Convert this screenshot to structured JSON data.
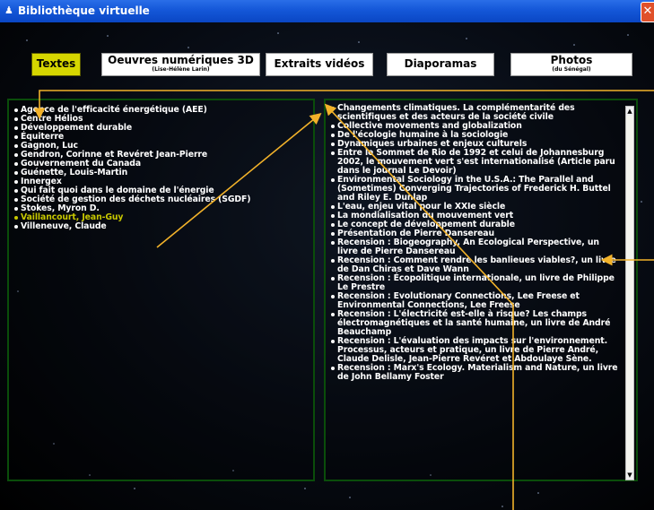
{
  "window": {
    "title": "Bibliothèque virtuelle",
    "app_icon": "person-icon",
    "close_label": "✕"
  },
  "tabs": [
    {
      "label": "Textes",
      "sub": "",
      "active": true
    },
    {
      "label": "Oeuvres numériques 3D",
      "sub": "(Lise-Hélène Larin)",
      "active": false
    },
    {
      "label": "Extraits vidéos",
      "sub": "",
      "active": false
    },
    {
      "label": "Diaporamas",
      "sub": "",
      "active": false
    },
    {
      "label": "Photos",
      "sub": "(du Sénégal)",
      "active": false
    }
  ],
  "authors": [
    "Agence de l'efficacité énergétique (AEE)",
    "Centre Hélios",
    "Développement durable",
    "Équiterre",
    "Gagnon, Luc",
    "Gendron, Corinne et Revéret Jean-Pierre",
    "Gouvernement du Canada",
    "Guénette, Louis-Martin",
    "Innergex",
    "Qui fait quoi dans le domaine de l'énergie",
    "Société de gestion des déchets nucléaires (SGDF)",
    "Stokes, Myron D.",
    "Vaillancourt, Jean-Guy",
    "Villeneuve, Claude"
  ],
  "selected_author": "Vaillancourt, Jean-Guy",
  "documents": [
    "Changements climatiques. La complémentarité des scientifiques et des acteurs de la société civile",
    "Collective movements and globalization",
    "De l'écologie humaine à la sociologie",
    "Dynamiques urbaines et enjeux culturels",
    "Entre le Sommet de Rio de 1992 et celui de Johannesburg 2002, le mouvement vert s'est internationalisé (Article paru dans le journal Le Devoir)",
    "Environmental Sociology in the U.S.A.: The Parallel and (Sometimes) Converging Trajectories of Frederick H. Buttel and Riley E. Dunlap",
    "L'eau, enjeu vital pour le XXIe siècle",
    "La mondialisation du mouvement vert",
    "Le concept de développement durable",
    "Présentation de Pierre Dansereau",
    "Recension : Biogeography, An Ecological Perspective, un livre de Pierre Dansereau",
    "Recension : Comment rendre les banlieues viables?, un livre de Dan Chiras et Dave Wann",
    "Recension : Écopolitique internationale, un livre de Philippe Le Prestre",
    "Recension : Evolutionary Connections, Lee Freese et Environmental Connections, Lee Freese",
    "Recension : L'électricité est-elle à risque? Les champs électromagnétiques et la santé humaine, un livre de André Beauchamp",
    "Recension : L'évaluation des impacts sur l'environnement. Processus, acteurs et pratique, un livre de Pierre André, Claude Delisle, Jean-Pierre Revéret et Abdoulaye Sène.",
    "Recension : Marx's Ecology. Materialism and Nature, un livre de John Bellamy Foster"
  ],
  "scrollbar": {
    "up": "▲",
    "down": "▼",
    "thumb_level": 0.0
  },
  "colors": {
    "active_tab": "#d6d600",
    "selected_item": "#c8c800",
    "panel_border": "#0a4d0a",
    "annotation": "#f2b22a",
    "titlebar": "#1457d8"
  }
}
